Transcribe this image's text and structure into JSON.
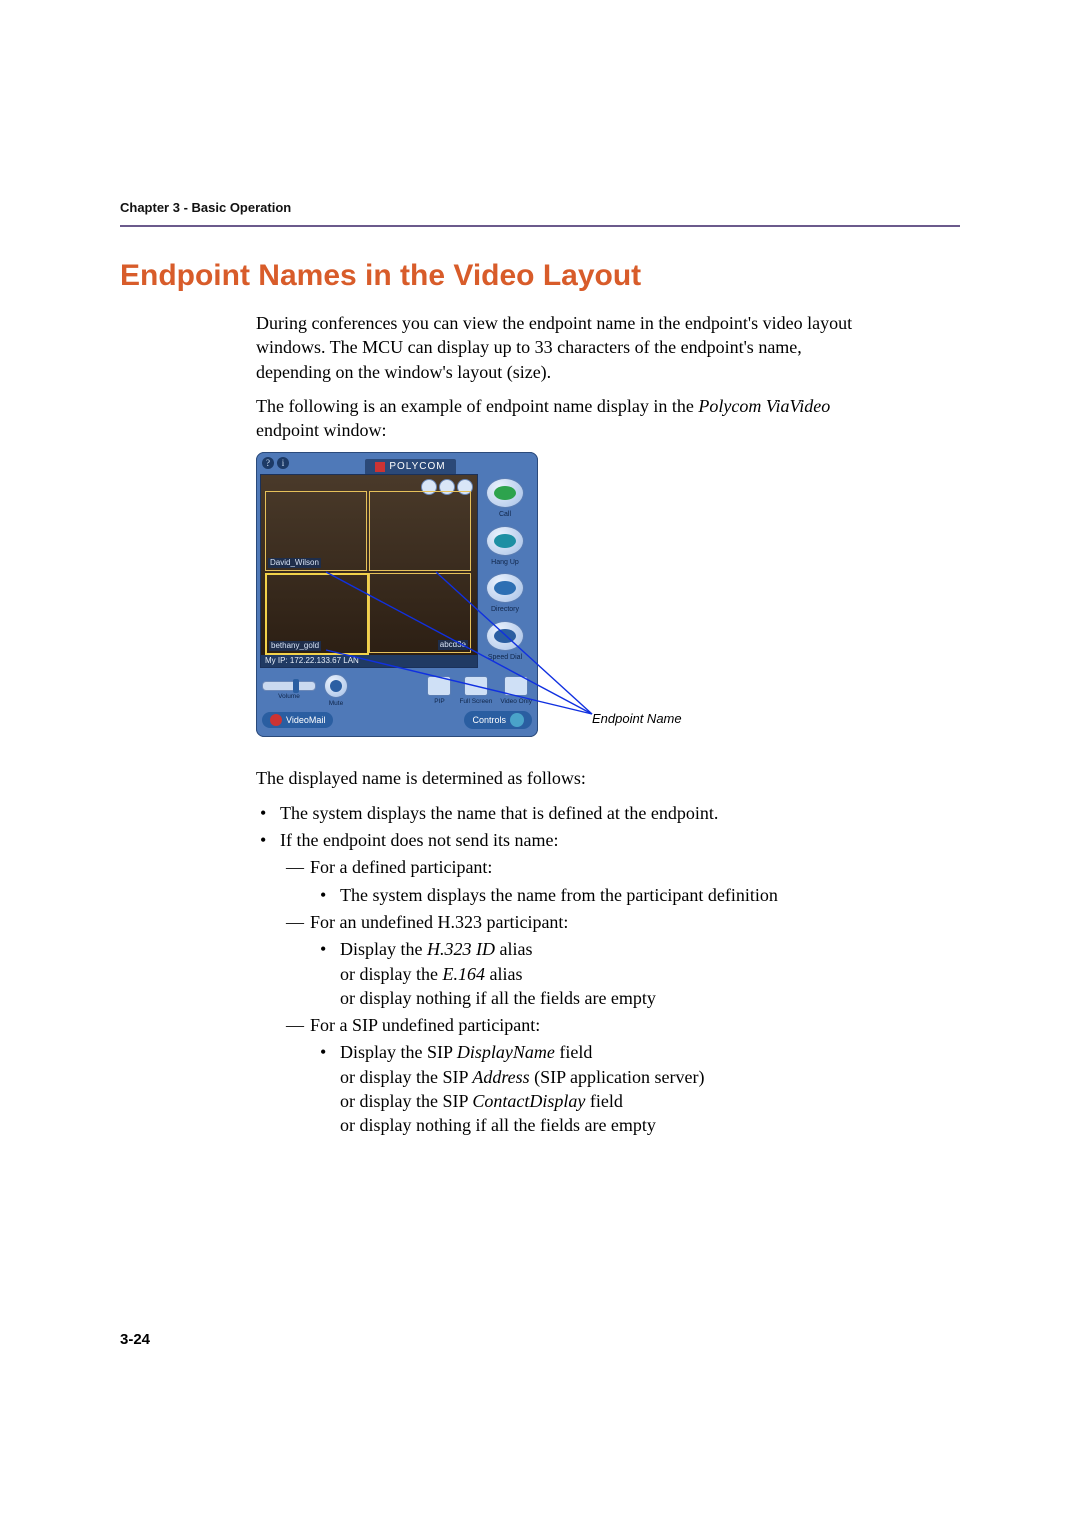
{
  "runningHead": "Chapter 3 - Basic Operation",
  "heading": "Endpoint Names in the Video Layout",
  "para1": "During conferences you can view the endpoint name in the endpoint's video layout windows. The MCU can display up to 33 characters of the endpoint's name, depending on the window's layout (size).",
  "para2a": "The following is an example of endpoint name display in the ",
  "para2b": "Polycom ViaVideo",
  "para2c": " endpoint window:",
  "figure": {
    "appTitle": "POLYCOM",
    "ipText": "My IP: 172.22.133.67  LAN",
    "label1": "David_Wilson",
    "label3": "abcd3e",
    "label4": "bethany_gold",
    "sideButtons": [
      "Call",
      "Hang Up",
      "Directory",
      "Speed Dial"
    ],
    "ctrlCaps": [
      "Volume",
      "Mute",
      "PIP",
      "Full Screen",
      "Video Only"
    ],
    "vmTab": "VideoMail",
    "controlsTab": "Controls",
    "callout": "Endpoint Name"
  },
  "para3": "The displayed name is determined as follows:",
  "b1": "The system displays the name that is defined at the endpoint.",
  "b2": "If the endpoint does not send its name:",
  "d1": "For a defined participant:",
  "d1b1": "The system displays the name from the participant definition",
  "d2": "For an undefined H.323 participant:",
  "d2b1a": "Display the ",
  "d2b1b": "H.323 ID",
  "d2b1c": " alias",
  "d2l2a": "or display the ",
  "d2l2b": "E.164",
  "d2l2c": " alias",
  "d2l3": "or display nothing if all the fields are empty",
  "d3": "For a SIP undefined participant:",
  "d3b1a": "Display the SIP ",
  "d3b1b": "DisplayName",
  "d3b1c": " field",
  "d3l2a": "or display the SIP ",
  "d3l2b": "Address",
  "d3l2c": " (SIP application server)",
  "d3l3a": "or display the SIP ",
  "d3l3b": "ContactDisplay",
  "d3l3c": " field",
  "d3l4": "or display nothing if all the fields are empty",
  "pageNumber": "3-24"
}
